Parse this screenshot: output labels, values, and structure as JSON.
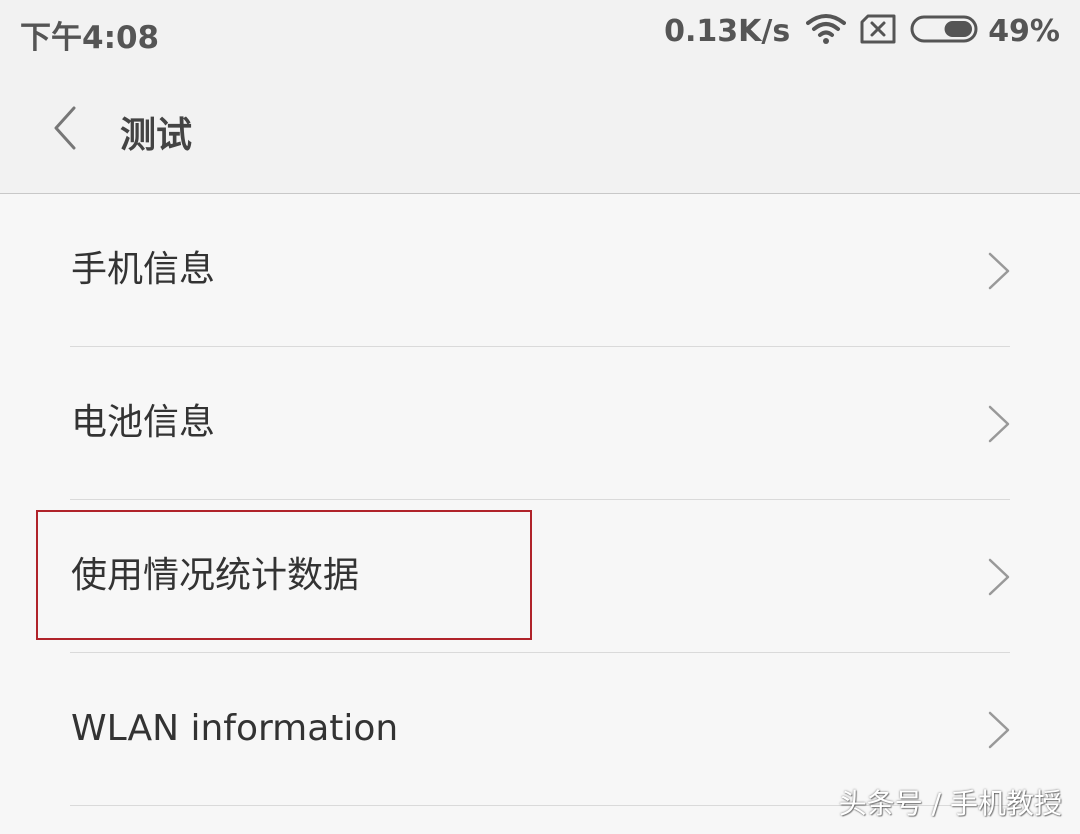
{
  "status_bar": {
    "time": "下午4:08",
    "net_speed": "0.13K/s",
    "battery_percent": "49%",
    "battery_level": 0.49,
    "icons": [
      "wifi-icon",
      "no-sim-icon",
      "battery-icon"
    ]
  },
  "header": {
    "back_icon": "chevron-left-icon",
    "title": "测试"
  },
  "list": {
    "items": [
      {
        "label": "手机信息"
      },
      {
        "label": "电池信息"
      },
      {
        "label": "使用情况统计数据"
      },
      {
        "label": "WLAN information"
      }
    ],
    "chevron_icon": "chevron-right-icon"
  },
  "annotation": {
    "highlight_color": "#b0232a"
  },
  "watermark": "头条号 / 手机教授"
}
